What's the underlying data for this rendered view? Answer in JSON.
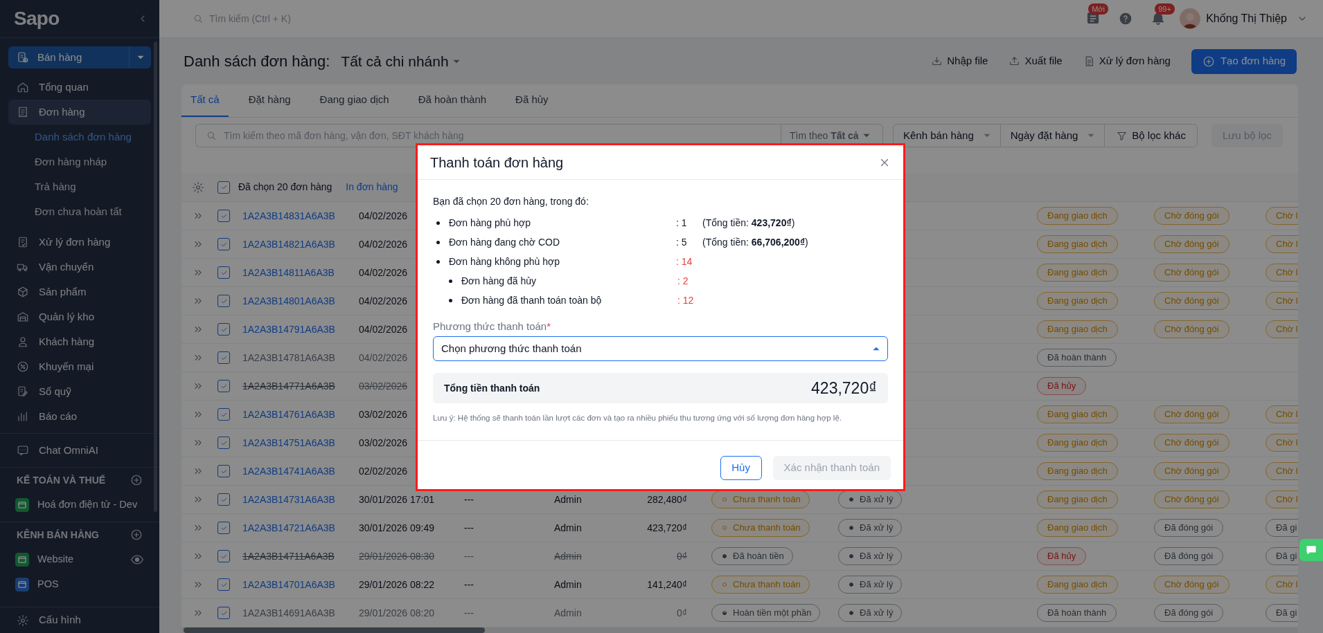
{
  "sidebar": {
    "logo": "Sapo",
    "store_switch": {
      "label": "Bán hàng",
      "selected": true
    },
    "items": [
      {
        "label": "Tổng quan",
        "selected": false
      },
      {
        "label": "Đơn hàng",
        "selected": true,
        "children": [
          {
            "label": "Danh sách đơn hàng",
            "selected": true
          },
          {
            "label": "Đơn hàng nháp",
            "selected": false
          },
          {
            "label": "Trả hàng",
            "selected": false
          },
          {
            "label": "Đơn chưa hoàn tất",
            "selected": false
          }
        ]
      },
      {
        "label": "Xử lý đơn hàng",
        "selected": false
      },
      {
        "label": "Vận chuyển",
        "selected": false
      },
      {
        "label": "Sản phẩm",
        "selected": false
      },
      {
        "label": "Quản lý kho",
        "selected": false
      },
      {
        "label": "Khách hàng",
        "selected": false
      },
      {
        "label": "Khuyến mại",
        "selected": false
      },
      {
        "label": "Sổ quỹ",
        "selected": false
      },
      {
        "label": "Báo cáo",
        "selected": false
      }
    ],
    "chat": {
      "label": "Chat OmniAI"
    },
    "sections": [
      {
        "title": "KẾ TOÁN VÀ THUẾ",
        "items": [
          {
            "label": "Hoá đơn điện tử - Dev",
            "kind": "invoice"
          }
        ]
      },
      {
        "title": "KÊNH BÁN HÀNG",
        "items": [
          {
            "label": "Website",
            "kind": "website"
          },
          {
            "label": "POS",
            "kind": "pos"
          }
        ]
      }
    ],
    "settings": {
      "label": "Cấu hình"
    }
  },
  "topbar": {
    "search": {
      "placeholder": "Tìm kiếm (Ctrl + K)"
    },
    "news_badge": "Mới",
    "alerts_badge": "99+",
    "user": {
      "name": "Khống Thị Thiệp"
    }
  },
  "page": {
    "title": "Danh sách đơn hàng:",
    "branch": "Tất cả chi nhánh",
    "actions": [
      {
        "label": "Nhập file",
        "kind": "import"
      },
      {
        "label": "Xuất file",
        "kind": "export"
      },
      {
        "label": "Xử lý đơn hàng",
        "kind": "process"
      },
      {
        "label": "Tạo đơn hàng",
        "kind": "create"
      }
    ]
  },
  "tabs": [
    {
      "label": "Tất cả",
      "selected": true
    },
    {
      "label": "Đặt hàng",
      "selected": false
    },
    {
      "label": "Đang giao dịch",
      "selected": false
    },
    {
      "label": "Đã hoàn thành",
      "selected": false
    },
    {
      "label": "Đã hủy",
      "selected": false
    }
  ],
  "filters": {
    "search": {
      "placeholder": "Tìm kiếm theo mã đơn hàng, vận đơn, SĐT khách hàng"
    },
    "search_scope": "Tìm theo **Tất cả**",
    "dropdowns": [
      "Kênh bán hàng",
      "Ngày đặt hàng"
    ],
    "more": "Bộ lọc khác",
    "save": "Lưu bộ lọc"
  },
  "table": {
    "selection": {
      "label": "Đã chọn 20 đơn hàng",
      "checked": true
    },
    "bulk_actions": [
      "In đơn hàng"
    ],
    "rows": [
      {
        "kind": "normal",
        "checked": true,
        "code": "1A2A3B14831A6A3B",
        "date": "04/02/2026",
        "status": {
          "label": "Đang giao dịch",
          "kind": "warning"
        },
        "packing": {
          "label": "Chờ đóng gói",
          "kind": "warning"
        },
        "delivery": {
          "label": "Chờ l",
          "kind": "warning"
        }
      },
      {
        "kind": "normal",
        "checked": true,
        "code": "1A2A3B14821A6A3B",
        "date": "04/02/2026",
        "status": {
          "label": "Đang giao dịch",
          "kind": "warning"
        },
        "packing": {
          "label": "Chờ đóng gói",
          "kind": "warning"
        },
        "delivery": {
          "label": "Chờ l",
          "kind": "warning"
        }
      },
      {
        "kind": "normal",
        "checked": true,
        "code": "1A2A3B14811A6A3B",
        "date": "04/02/2026",
        "status": {
          "label": "Đang giao dịch",
          "kind": "warning"
        },
        "packing": {
          "label": "Chờ đóng gói",
          "kind": "warning"
        },
        "delivery": {
          "label": "Chờ l",
          "kind": "warning"
        }
      },
      {
        "kind": "normal",
        "checked": true,
        "code": "1A2A3B14801A6A3B",
        "date": "04/02/2026",
        "status": {
          "label": "Đang giao dịch",
          "kind": "warning"
        },
        "packing": {
          "label": "Chờ đóng gói",
          "kind": "warning"
        },
        "delivery": {
          "label": "Chờ l",
          "kind": "warning"
        }
      },
      {
        "kind": "normal",
        "checked": true,
        "code": "1A2A3B14791A6A3B",
        "date": "04/02/2026",
        "status": {
          "label": "Đang giao dịch",
          "kind": "warning"
        },
        "packing": {
          "label": "Chờ đóng gói",
          "kind": "warning"
        },
        "delivery": {
          "label": "Chờ l",
          "kind": "warning"
        }
      },
      {
        "kind": "completed",
        "checked": true,
        "code": "1A2A3B14781A6A3B",
        "date": "04/02/2026",
        "status": {
          "label": "Đã hoàn thành",
          "kind": "neutral"
        }
      },
      {
        "kind": "cancelled",
        "checked": true,
        "code": "1A2A3B14771A6A3B",
        "date": "03/02/2026",
        "status": {
          "label": "Đã hủy",
          "kind": "danger"
        }
      },
      {
        "kind": "normal",
        "checked": true,
        "code": "1A2A3B14761A6A3B",
        "date": "03/02/2026",
        "status": {
          "label": "Đang giao dịch",
          "kind": "warning"
        },
        "packing": {
          "label": "Chờ đóng gói",
          "kind": "warning"
        },
        "delivery": {
          "label": "Chờ l",
          "kind": "warning"
        }
      },
      {
        "kind": "normal",
        "checked": true,
        "code": "1A2A3B14751A6A3B",
        "date": "03/02/2026",
        "status": {
          "label": "Đang giao dịch",
          "kind": "warning"
        },
        "packing": {
          "label": "Chờ đóng gói",
          "kind": "warning"
        },
        "delivery": {
          "label": "Chờ l",
          "kind": "warning"
        }
      },
      {
        "kind": "normal",
        "checked": true,
        "code": "1A2A3B14741A6A3B",
        "date": "02/02/2026",
        "status": {
          "label": "Đang giao dịch",
          "kind": "warning"
        },
        "packing": {
          "label": "Chờ đóng gói",
          "kind": "warning"
        },
        "delivery": {
          "label": "Chờ l",
          "kind": "warning"
        }
      },
      {
        "kind": "normal",
        "checked": true,
        "code": "1A2A3B14731A6A3B",
        "date": "30/01/2026 17:01",
        "column_3": "---",
        "column_4": "Admin",
        "amount": "282,480₫",
        "payment": {
          "label": "Chưa thanh toán",
          "kind": "unpaid"
        },
        "processing": {
          "label": "Đã xử lý"
        },
        "status": {
          "label": "Đang giao dịch",
          "kind": "warning"
        },
        "packing": {
          "label": "Chờ đóng gói",
          "kind": "warning"
        },
        "delivery": {
          "label": "Chờ l",
          "kind": "warning"
        }
      },
      {
        "kind": "normal",
        "checked": true,
        "code": "1A2A3B14721A6A3B",
        "date": "30/01/2026 09:49",
        "column_3": "---",
        "column_4": "Admin",
        "amount": "423,720₫",
        "payment": {
          "label": "Chưa thanh toán",
          "kind": "unpaid"
        },
        "processing": {
          "label": "Đã xử lý"
        },
        "status": {
          "label": "Đang giao dịch",
          "kind": "warning"
        },
        "packing": {
          "label": "Đã đóng gói",
          "kind": "neutral"
        },
        "delivery": {
          "label": "Đã gi",
          "kind": "neutral"
        }
      },
      {
        "kind": "cancelled",
        "checked": true,
        "code": "1A2A3B14711A6A3B",
        "date": "29/01/2026 08:30",
        "column_3": "---",
        "column_4": "Admin",
        "amount": "0₫",
        "payment": {
          "label": "Đã hoàn tiền",
          "kind": "refunded"
        },
        "processing": {
          "label": "Đã xử lý"
        },
        "status": {
          "label": "Đã hủy",
          "kind": "danger"
        },
        "packing": {
          "label": "Đã đóng gói",
          "kind": "neutral"
        },
        "delivery": {
          "label": "Đã gi",
          "kind": "neutral"
        }
      },
      {
        "kind": "normal",
        "checked": true,
        "code": "1A2A3B14701A6A3B",
        "date": "29/01/2026 08:22",
        "column_3": "---",
        "column_4": "Admin",
        "amount": "141,240₫",
        "payment": {
          "label": "Chưa thanh toán",
          "kind": "unpaid"
        },
        "processing": {
          "label": "Đã xử lý"
        },
        "status": {
          "label": "Đang giao dịch",
          "kind": "warning"
        },
        "packing": {
          "label": "Chờ đóng gói",
          "kind": "warning"
        },
        "delivery": {
          "label": "Chờ l",
          "kind": "warning"
        }
      },
      {
        "kind": "completed",
        "checked": true,
        "code": "1A2A3B14691A6A3B",
        "date": "29/01/2026 08:20",
        "column_3": "---",
        "column_4": "Admin",
        "amount": "0₫",
        "payment": {
          "label": "Hoàn tiền một phần",
          "kind": "partial"
        },
        "processing": {
          "label": "Đã xử lý"
        },
        "status": {
          "label": "Đã hoàn thành",
          "kind": "neutral"
        },
        "packing": {
          "label": "Đã đóng gói",
          "kind": "neutral"
        },
        "delivery": {
          "label": "Đã gi",
          "kind": "neutral"
        }
      }
    ]
  },
  "dialog": {
    "title": "Thanh toán đơn hàng",
    "intro": "Bạn đã chọn 20 đơn hàng, trong đó:",
    "summary": [
      {
        "label": "Đơn hàng phù hợp",
        "count": ": 1",
        "total": "(Tổng tiền: **423,720₫**)",
        "warning": false
      },
      {
        "label": "Đơn hàng đang chờ COD",
        "count": ": 5",
        "total": "(Tổng tiền: **66,706,200₫**)",
        "warning": false
      },
      {
        "label": "Đơn hàng không phù hợp",
        "count": ": 14",
        "warning": true,
        "children": [
          {
            "label": "Đơn hàng đã hủy",
            "count": ": 2",
            "warning": true
          },
          {
            "label": "Đơn hàng đã thanh toán toàn bộ",
            "count": ": 12",
            "warning": true
          }
        ]
      }
    ],
    "payment_method": {
      "label": "Phương thức thanh toán",
      "required_mark": "*",
      "placeholder": "Chọn phương thức thanh toán",
      "expanded": true
    },
    "total": {
      "label": "Tổng tiền thanh toán",
      "value": "423,720₫"
    },
    "note": "Lưu ý: Hệ thống sẽ thanh toán lần lượt các đơn và tạo ra nhiều phiếu thu tương ứng với số lượng đơn hàng hợp lệ.",
    "buttons": [
      {
        "label": "Hủy",
        "kind": "secondary",
        "disabled": false
      },
      {
        "label": "Xác nhận thanh toán",
        "kind": "primary",
        "disabled": true
      }
    ]
  }
}
